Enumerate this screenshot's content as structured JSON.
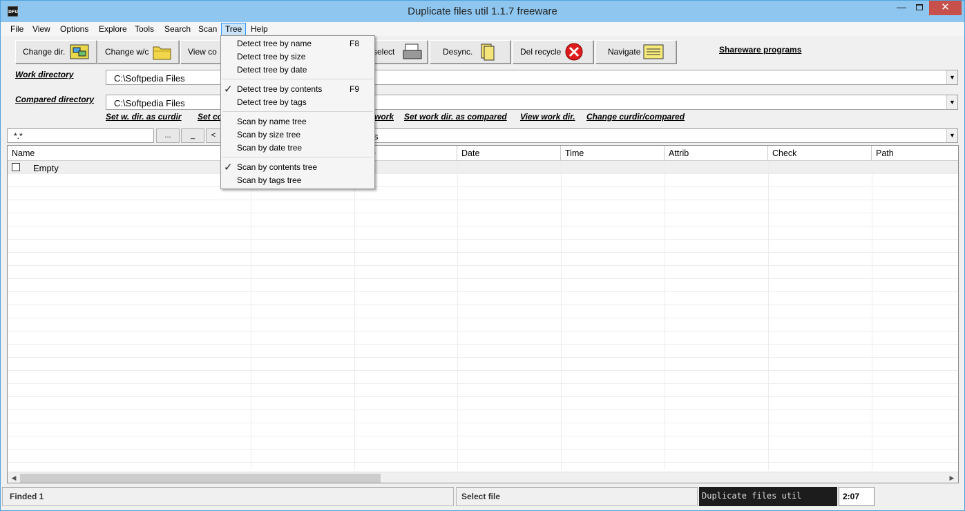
{
  "window": {
    "icon_text": "DFU",
    "title": "Duplicate files util 1.1.7 freeware",
    "min_glyph": "—",
    "close_glyph": "✕"
  },
  "menubar": {
    "items": [
      "File",
      "View",
      "Options",
      "Explore",
      "Tools",
      "Search",
      "Scan",
      "Tree",
      "Help"
    ],
    "active": "Tree"
  },
  "toolbar": {
    "change_dir": "Change dir.",
    "change_wc": "Change w/c",
    "view_co": "View co",
    "select": "select",
    "desync": "Desync.",
    "del_recycle": "Del recycle",
    "navigate": "Navigate",
    "shareware": "Shareware programs"
  },
  "directories": {
    "work_label": "Work directory",
    "work_value": "C:\\Softpedia Files",
    "compared_label": "Compared directory",
    "compared_value": "C:\\Softpedia Files"
  },
  "links": {
    "set_w_dir": "Set w. dir. as curdir",
    "set_co": "Set co",
    "work": "work",
    "set_work_compared": "Set work dir. as compared",
    "view_work": "View work dir.",
    "change_curdir": "Change curdir/compared"
  },
  "filter": {
    "mask": "*.*",
    "btn_browse": "...",
    "btn_underscore": "_",
    "btn_lt": "<",
    "combo_partial": "s"
  },
  "grid": {
    "columns": [
      "Name",
      "e",
      "Date",
      "Time",
      "Attrib",
      "Check",
      "Path"
    ],
    "rows": [
      {
        "name": "Empty",
        "checked": false
      }
    ]
  },
  "statusbar": {
    "finded": "Finded 1",
    "select_file": "Select file",
    "banner": "Duplicate files util",
    "time": "2:07 PM"
  },
  "tree_menu": {
    "items": [
      {
        "label": "Detect tree by name",
        "shortcut": "F8",
        "checked": false
      },
      {
        "label": "Detect tree by size",
        "shortcut": "",
        "checked": false
      },
      {
        "label": "Detect tree by date",
        "shortcut": "",
        "checked": false
      },
      {
        "label": "Detect tree by contents",
        "shortcut": "F9",
        "checked": true
      },
      {
        "label": "Detect tree by tags",
        "shortcut": "",
        "checked": false
      },
      {
        "label": "Scan by name tree",
        "shortcut": "",
        "checked": false
      },
      {
        "label": "Scan by size tree",
        "shortcut": "",
        "checked": false
      },
      {
        "label": "Scan by date tree",
        "shortcut": "",
        "checked": false
      },
      {
        "label": "Scan by contents tree",
        "shortcut": "",
        "checked": true
      },
      {
        "label": "Scan by tags tree",
        "shortcut": "",
        "checked": false
      }
    ],
    "check_glyph": "✓"
  }
}
